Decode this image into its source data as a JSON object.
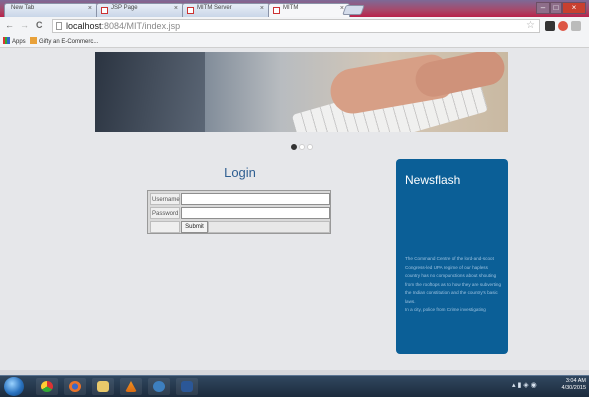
{
  "browser": {
    "tabs": [
      {
        "label": "New Tab",
        "active": false
      },
      {
        "label": "JSP Page",
        "active": false
      },
      {
        "label": "MITM Server",
        "active": false
      },
      {
        "label": "MITM",
        "active": true
      }
    ],
    "tab_close": "×",
    "address": {
      "host": "localhost",
      "rest": ":8084/MIT/index.jsp"
    },
    "nav": {
      "back": "←",
      "forward": "→",
      "reload": "C"
    },
    "star": "☆",
    "bookmarks": [
      {
        "label": "Apps",
        "icon": "apps-icon"
      },
      {
        "label": "Gifty an E-Commerc...",
        "icon": "bookmark-icon"
      }
    ],
    "window_controls": {
      "minimize": "–",
      "maximize": "□",
      "close": "×"
    }
  },
  "page": {
    "carousel": {
      "slides": 3,
      "active_index": 0
    },
    "login": {
      "title": "Login",
      "username_label": "Username",
      "password_label": "Password",
      "username_value": "",
      "password_value": "",
      "submit_label": "Submit"
    },
    "newsflash": {
      "title": "Newsflash",
      "paragraphs": [
        "The Command Centre of the lord-and-scoot Congress-led UPA regime of our hapless country has no compunctions about shouting from the rooftops as to how they are subverting the Indian constitution and the country's basic laws.",
        "In a city, police from Crime investigating"
      ]
    }
  },
  "taskbar": {
    "clock_time": "3:04 AM",
    "clock_date": "4/30/2015",
    "apps": [
      "internet-explorer-icon",
      "chrome-icon",
      "firefox-icon",
      "file-explorer-icon",
      "vlc-icon",
      "app-icon",
      "word-icon"
    ]
  },
  "colors": {
    "login_title": "#2f5f92",
    "newsflash_bg": "#0b5f97",
    "page_bg": "#e6e7ea"
  }
}
